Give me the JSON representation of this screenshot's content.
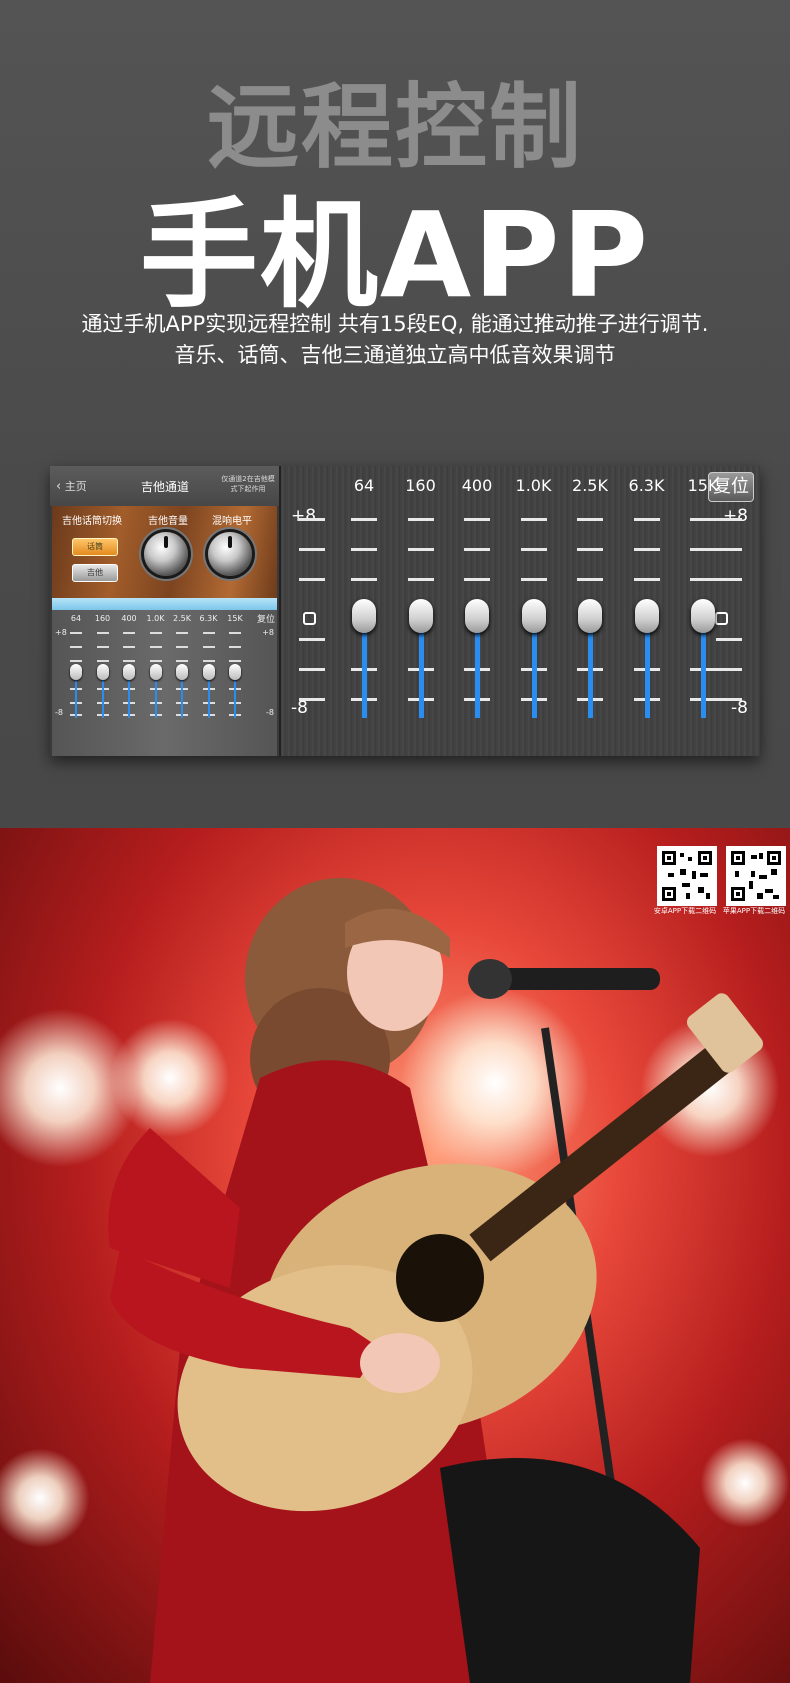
{
  "banner": {
    "title_line1": "远程控制",
    "title_line2": "手机APP",
    "subtitle_line1": "通过手机APP实现远程控制  共有15段EQ, 能通过推动推子进行调节.",
    "subtitle_line2": "音乐、话筒、吉他三通道独立高中低音效果调节"
  },
  "app": {
    "header": {
      "back_label": "主页",
      "title": "吉他通道",
      "note": "仅通道2在吉他模式下起作用"
    },
    "controls": {
      "switch_label": "吉他话筒切换",
      "volume_label": "吉他音量",
      "reverb_label": "混响电平",
      "mic_button": "话筒",
      "guitar_button": "吉他"
    },
    "eq_small": {
      "freqs": [
        "64",
        "160",
        "400",
        "1.0K",
        "2.5K",
        "6.3K",
        "15K"
      ],
      "reset_label": "复位",
      "top_label": "+8",
      "bottom_label": "-8",
      "levels": [
        0,
        0,
        0,
        0,
        0,
        0,
        0
      ]
    },
    "eq_large": {
      "freqs": [
        "64",
        "160",
        "400",
        "1.0K",
        "2.5K",
        "6.3K",
        "15K"
      ],
      "reset_label": "复位",
      "top_label": "+8",
      "bottom_label": "-8",
      "levels": [
        0,
        0,
        0,
        0,
        0,
        0,
        0
      ]
    }
  },
  "photo": {
    "qr_android_caption": "安卓APP下载二维码",
    "qr_apple_caption": "苹果APP下载二维码"
  },
  "colors": {
    "accent_blue": "#2a8ef0",
    "button_orange": "#e38a1e"
  }
}
